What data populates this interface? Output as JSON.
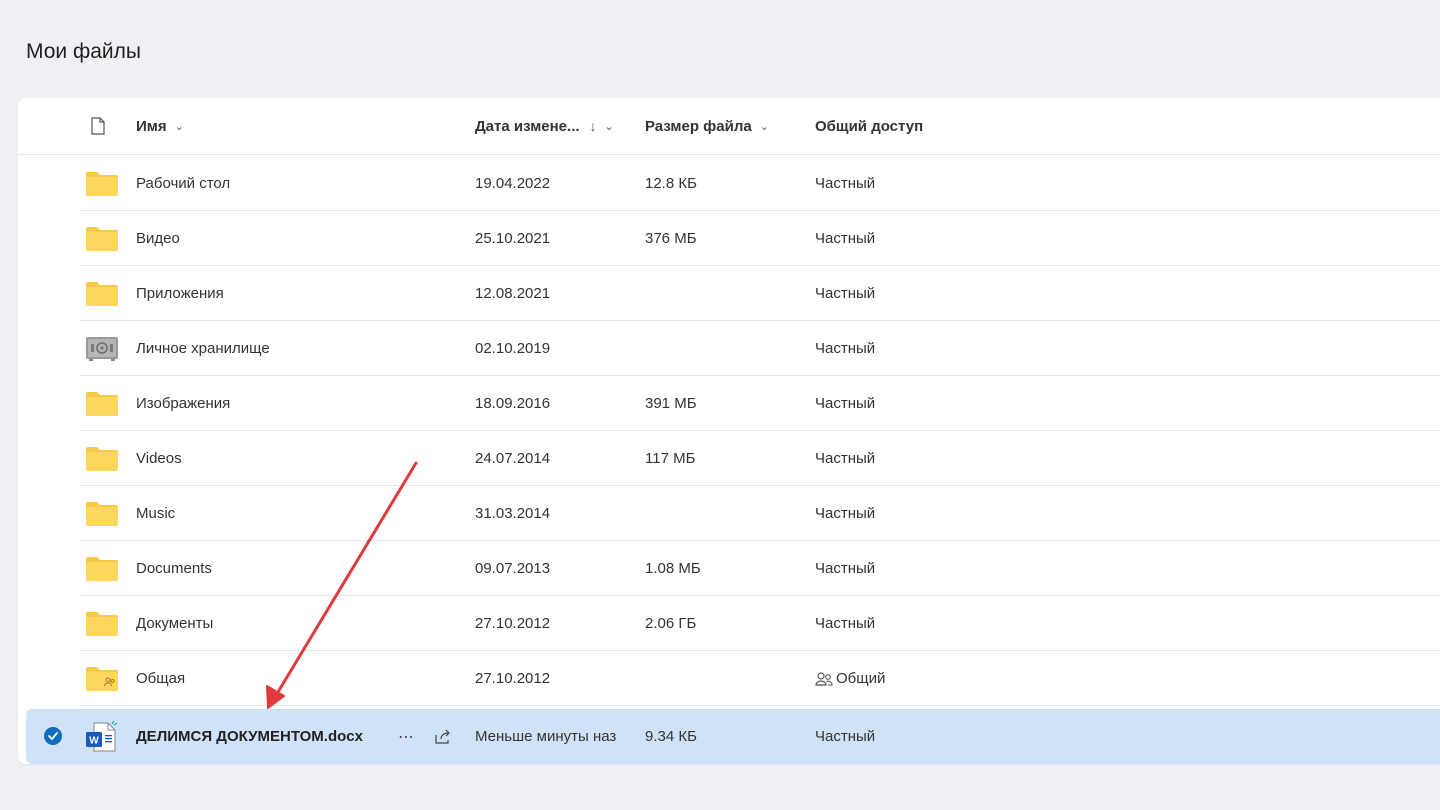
{
  "page": {
    "title": "Мои файлы"
  },
  "columns": {
    "name": "Имя",
    "modified": "Дата измене...",
    "size": "Размер файла",
    "sharing": "Общий доступ"
  },
  "rows": [
    {
      "name": "Рабочий стол",
      "modified": "19.04.2022",
      "size": "12.8 КБ",
      "sharing": "Частный",
      "icon": "folder-icon"
    },
    {
      "name": "Видео",
      "modified": "25.10.2021",
      "size": "376 МБ",
      "sharing": "Частный",
      "icon": "folder-icon"
    },
    {
      "name": "Приложения",
      "modified": "12.08.2021",
      "size": "",
      "sharing": "Частный",
      "icon": "folder-icon"
    },
    {
      "name": "Личное хранилище",
      "modified": "02.10.2019",
      "size": "",
      "sharing": "Частный",
      "icon": "vault-icon"
    },
    {
      "name": "Изображения",
      "modified": "18.09.2016",
      "size": "391 МБ",
      "sharing": "Частный",
      "icon": "folder-icon"
    },
    {
      "name": "Videos",
      "modified": "24.07.2014",
      "size": "117 МБ",
      "sharing": "Частный",
      "icon": "folder-icon"
    },
    {
      "name": "Music",
      "modified": "31.03.2014",
      "size": "",
      "sharing": "Частный",
      "icon": "folder-icon"
    },
    {
      "name": "Documents",
      "modified": "09.07.2013",
      "size": "1.08 МБ",
      "sharing": "Частный",
      "icon": "folder-icon"
    },
    {
      "name": "Документы",
      "modified": "27.10.2012",
      "size": "2.06 ГБ",
      "sharing": "Частный",
      "icon": "folder-icon"
    },
    {
      "name": "Общая",
      "modified": "27.10.2012",
      "size": "",
      "sharing": "Общий",
      "icon": "shared-folder-icon"
    },
    {
      "name": "ДЕЛИМСЯ ДОКУМЕНТОМ.docx",
      "modified": "Меньше минуты наз",
      "size": "9.34 КБ",
      "sharing": "Частный",
      "icon": "word-document-icon",
      "selected": true
    }
  ],
  "colors": {
    "accent": "#0f6cbd",
    "selected_row": "#cfe2f8",
    "folder": "#ffd75e",
    "annotation_arrow": "#e0393e"
  }
}
